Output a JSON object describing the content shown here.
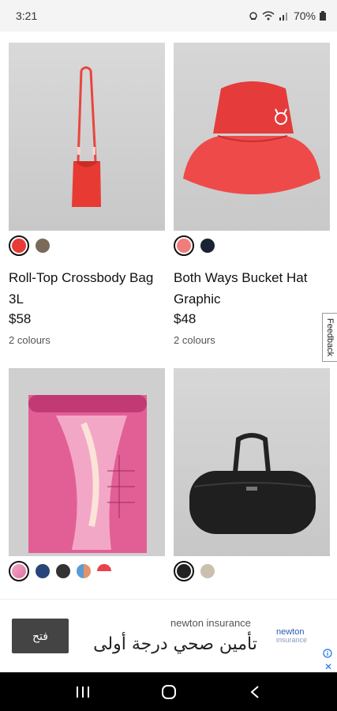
{
  "status_bar": {
    "time": "3:21",
    "battery": "70%"
  },
  "products": [
    {
      "title": "Roll-Top Crossbody Bag 3L",
      "price": "$58",
      "colours": "2 colours",
      "swatches": [
        "#e83a36",
        "#7b6a5a"
      ],
      "selected_swatch": 0,
      "image": "red-crossbody-bag"
    },
    {
      "title": "Both Ways Bucket Hat Graphic",
      "price": "$48",
      "colours": "2 colours",
      "swatches": [
        "#f07c7c",
        "#1b2233"
      ],
      "selected_swatch": 0,
      "image": "red-bucket-hat"
    },
    {
      "title": "",
      "price": "",
      "colours": "",
      "swatches": [
        "#e26fa2",
        "#27457a",
        "#333333",
        "#e3926a",
        "#e8424a"
      ],
      "selected_swatch": 0,
      "image": "pink-yoga-mat"
    },
    {
      "title": "",
      "price": "",
      "colours": "",
      "swatches": [
        "#222222",
        "#c9c1ad"
      ],
      "selected_swatch": 0,
      "image": "black-duffel-bag"
    }
  ],
  "feedback": {
    "label": "Feedback"
  },
  "ad": {
    "button_label": "فتح",
    "brand": "newton insurance",
    "headline": "تأمين صحي درجة أولى",
    "logo_text": "newton",
    "logo_sub": "insurance"
  },
  "nav": {
    "recent": "recent-apps-icon",
    "home": "home-icon",
    "back": "back-icon"
  }
}
